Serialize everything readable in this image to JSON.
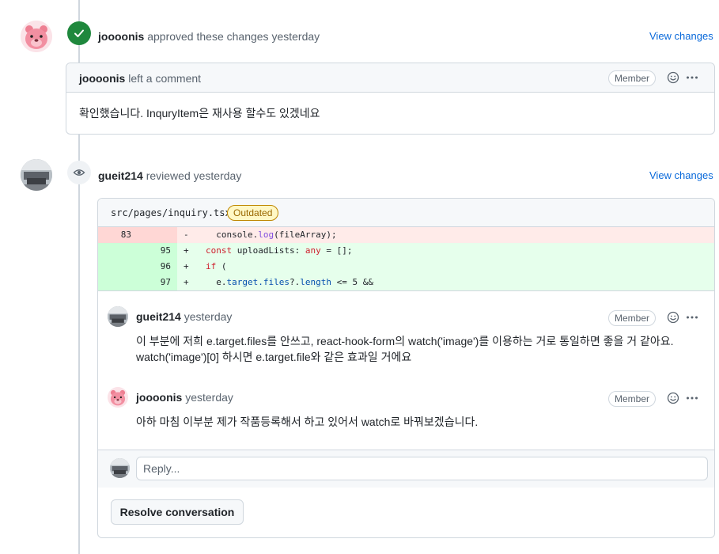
{
  "events": [
    {
      "user": "joooonis",
      "action": "approved these changes",
      "time": "yesterday",
      "view_changes": "View changes",
      "comment": {
        "author": "joooonis",
        "action": "left a comment",
        "role": "Member",
        "body": "확인했습니다. InquryItem은 재사용 할수도 있겠네요"
      }
    },
    {
      "user": "gueit214",
      "action": "reviewed",
      "time": "yesterday",
      "view_changes": "View changes"
    }
  ],
  "review": {
    "file_path": "src/pages/inquiry.tsx",
    "status": "Outdated",
    "diff": [
      {
        "type": "del",
        "old": "83",
        "new": "",
        "sign": "-"
      },
      {
        "type": "add",
        "old": "",
        "new": "95",
        "sign": "+"
      },
      {
        "type": "add",
        "old": "",
        "new": "96",
        "sign": "+"
      },
      {
        "type": "add",
        "old": "",
        "new": "97",
        "sign": "+"
      }
    ],
    "diff_code": {
      "l1_a": "  console.",
      "l1_fn": "log",
      "l1_b": "(fileArray);",
      "l2_kw": "const",
      "l2_b": " uploadLists: ",
      "l2_kw2": "any",
      "l2_c": " = [];",
      "l3_kw": "if",
      "l3_b": " (",
      "l4_a": "  e.",
      "l4_pr": "target.files",
      "l4_b": "?.",
      "l4_pr2": "length",
      "l4_c": " <= 5 &&"
    },
    "comments": [
      {
        "author": "gueit214",
        "time": "yesterday",
        "role": "Member",
        "body_line1": "이 부분에 저희 e.target.files를 안쓰고, react-hook-form의 watch('image')를 이용하는 거로 통일하면 좋을 거 같아요.",
        "body_line2": "watch('image')[0] 하시면 e.target.file와 같은 효과일 거에요"
      },
      {
        "author": "joooonis",
        "time": "yesterday",
        "role": "Member",
        "body_line1": "아하 마침 이부분 제가 작품등록해서 하고 있어서 watch로 바꿔보겠습니다."
      }
    ],
    "reply_placeholder": "Reply...",
    "resolve_label": "Resolve conversation"
  },
  "colors": {
    "approved": "#1f883d",
    "link": "#0969da",
    "deletion_bg": "#ffebe9",
    "addition_bg": "#e6ffec"
  },
  "icons": [
    "check-icon",
    "eye-icon",
    "smiley-icon",
    "kebab-icon"
  ]
}
